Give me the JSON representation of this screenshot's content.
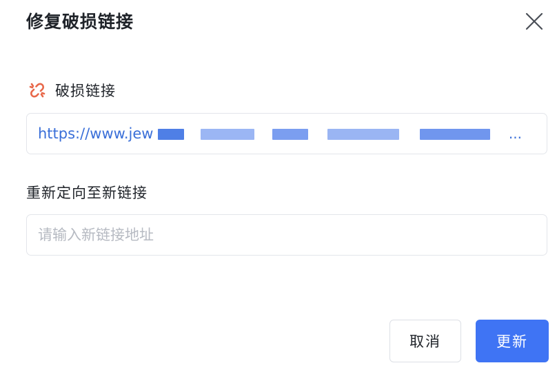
{
  "dialog": {
    "title": "修复破损链接",
    "close_icon": "close-icon"
  },
  "broken_link": {
    "label": "破损链接",
    "icon": "broken-link-icon",
    "icon_color": "#e8684a",
    "url_visible": "https://www.jew",
    "ellipsis": "..."
  },
  "redirect": {
    "label": "重新定向至新链接",
    "placeholder": "请输入新链接地址",
    "value": ""
  },
  "buttons": {
    "cancel": "取消",
    "update": "更新"
  },
  "colors": {
    "primary": "#3f74f4",
    "link_text": "#3a6fd8",
    "placeholder": "#b6bac2",
    "border": "#e3e5ea"
  }
}
